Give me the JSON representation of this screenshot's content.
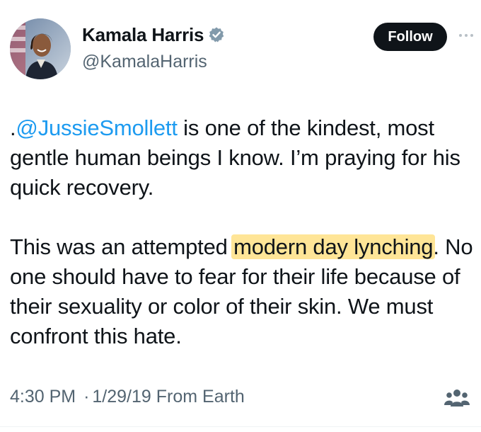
{
  "author": {
    "display_name": "Kamala Harris",
    "handle": "@KamalaHarris",
    "verified_icon": "verified-badge-icon",
    "avatar_icon": "profile-photo"
  },
  "actions": {
    "follow_label": "Follow",
    "more_icon": "more-options-icon"
  },
  "tweet": {
    "paragraph1": {
      "prefix": ".",
      "mention": "@JussieSmollett",
      "rest": " is one of the kindest, most gentle human beings I know. I’m praying for his quick recovery."
    },
    "paragraph2": {
      "before": "This was an attempted ",
      "highlighted": "modern day lynching",
      "after": ". No one should have to fear for their life because of their sexuality or color of their skin. We must confront this hate."
    }
  },
  "meta": {
    "time": "4:30 PM",
    "separator": "·",
    "date": "1/29/19",
    "source": "From Earth",
    "audience_icon": "community-people-icon"
  },
  "colors": {
    "text": "#0f1419",
    "secondary": "#536471",
    "mention": "#1d9bf0",
    "highlight": "#ffe597",
    "verified": "#829aab",
    "follow_bg": "#0f1419"
  }
}
